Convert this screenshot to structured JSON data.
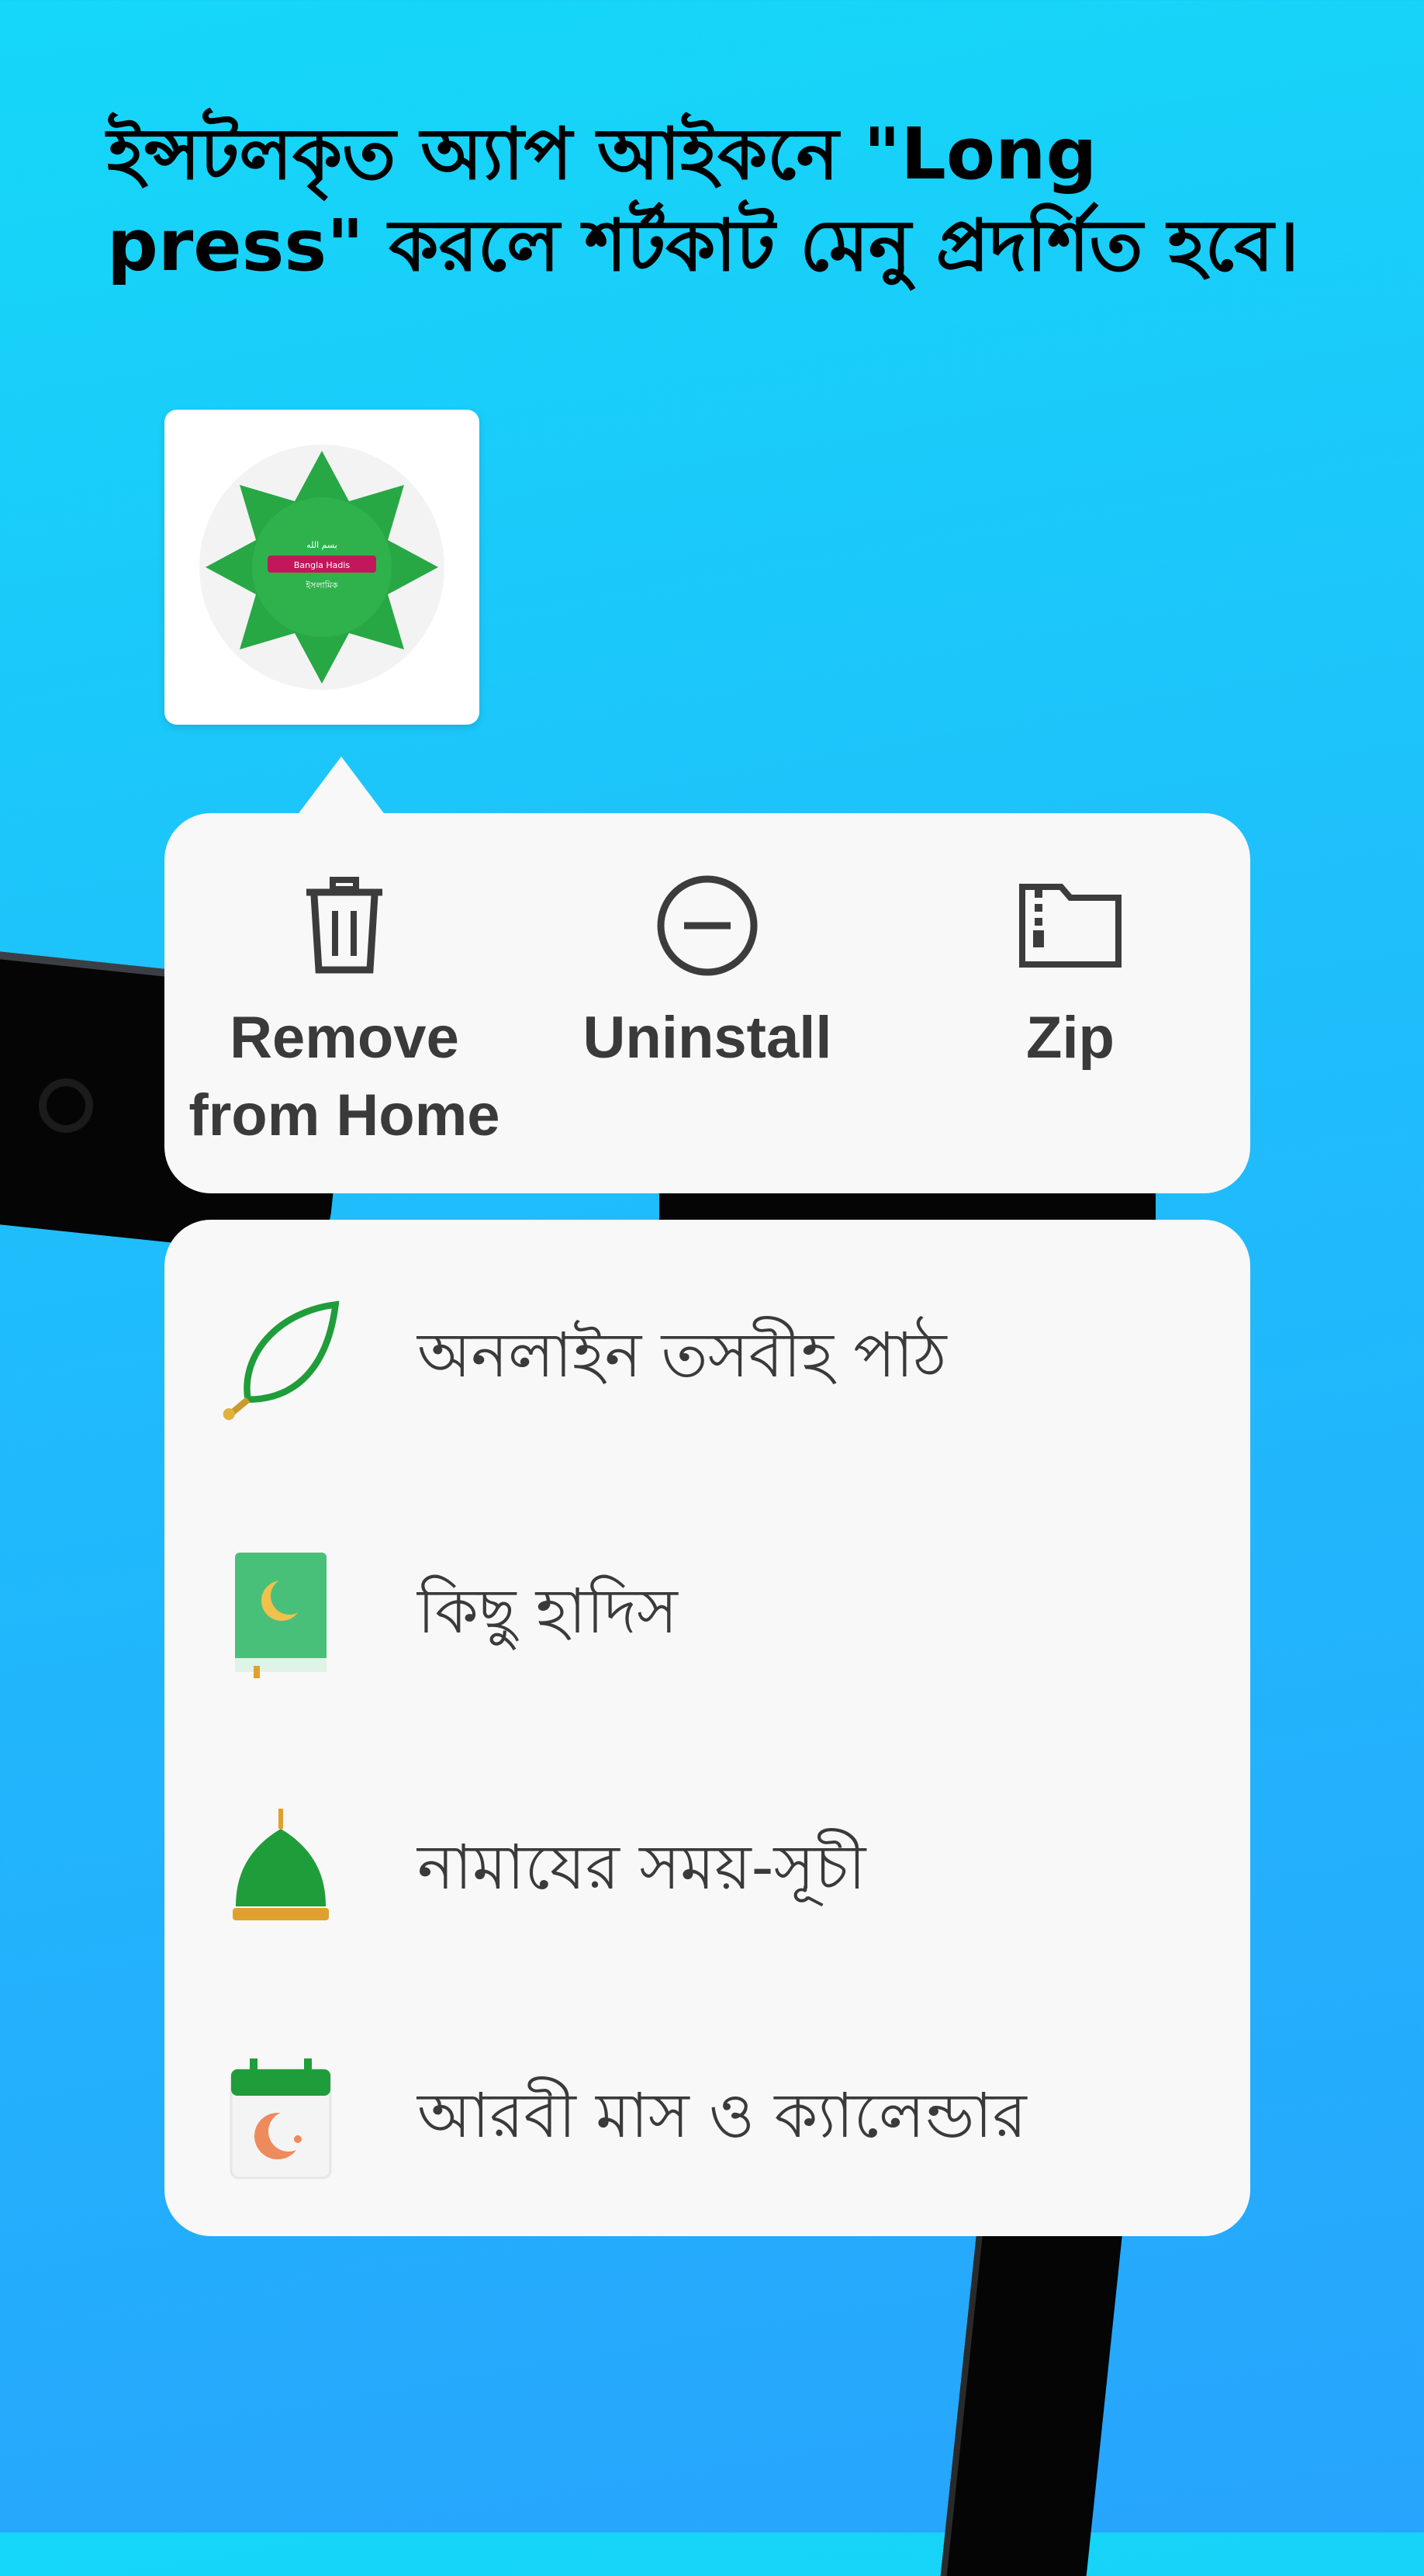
{
  "headline": "ইন্সটলকৃত অ্যাপ আইকনে \"Long press\" করলে শর্টকাট মেনু প্রদর্শিত হবে।",
  "app_icon": {
    "line1": "بسم الله",
    "line2": "Bangla Hadis",
    "line3": "ইসলামিক"
  },
  "shortcut_actions": [
    {
      "label": "Remove from Home",
      "icon": "trash-icon"
    },
    {
      "label": "Uninstall",
      "icon": "minus-circle-icon"
    },
    {
      "label": "Zip",
      "icon": "zip-folder-icon"
    }
  ],
  "app_shortcuts": [
    {
      "label": "অনলাইন তসবীহ পাঠ",
      "icon": "tasbih-leaf-icon"
    },
    {
      "label": "কিছু হাদিস",
      "icon": "book-icon"
    },
    {
      "label": "নামাযের সময়-সূচী",
      "icon": "mosque-dome-icon"
    },
    {
      "label": "আরবী মাস ও ক্যালেন্ডার",
      "icon": "calendar-crescent-icon"
    }
  ],
  "colors": {
    "background_top": "#15d8f8",
    "background_bottom": "#27a4fd",
    "card": "#f8f8f8",
    "icon_green": "#2eb24a"
  }
}
